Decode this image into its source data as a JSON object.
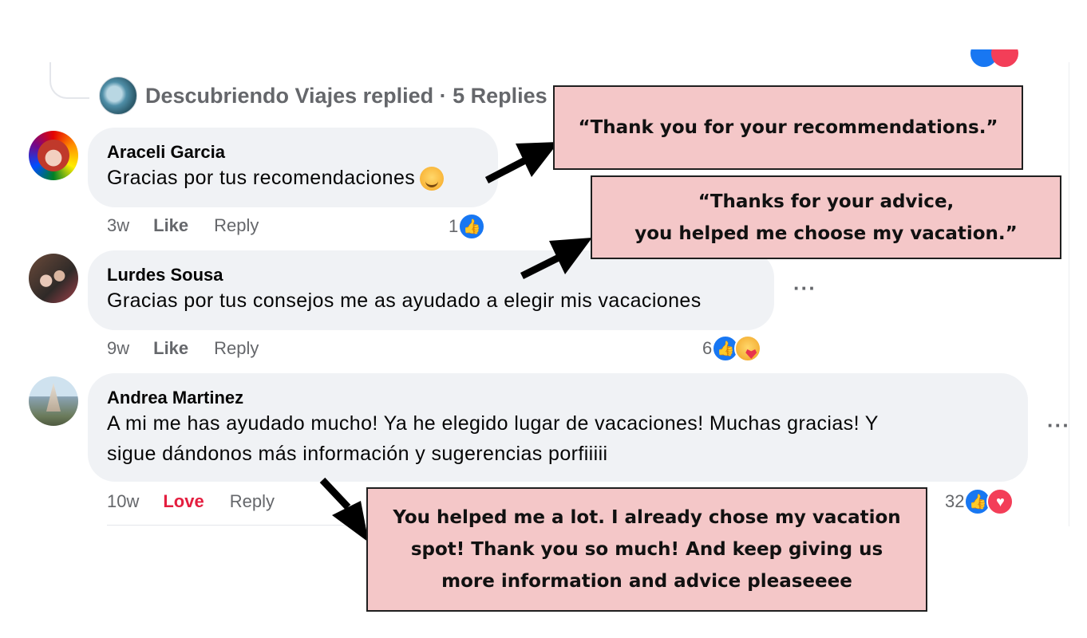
{
  "thread": {
    "replied_label": "Descubriendo Viajes replied · 5 Replies"
  },
  "comments": [
    {
      "author": "Araceli Garcia",
      "text": "Gracias por tus recomendaciones",
      "time": "3w",
      "action": "Like",
      "reply": "Reply",
      "reaction_count": "1",
      "reactions": [
        "like-icon"
      ]
    },
    {
      "author": "Lurdes Sousa",
      "text": "Gracias por tus consejos me as ayudado a elegir mis vacaciones",
      "time": "9w",
      "action": "Like",
      "reply": "Reply",
      "reaction_count": "6",
      "reactions": [
        "like-icon",
        "care-icon"
      ]
    },
    {
      "author": "Andrea Martinez",
      "text_line1": "A mi me has ayudado mucho! Ya he elegido lugar de vacaciones! Muchas gracias! Y",
      "text_line2": "sigue dándonos más información y sugerencias porfiiiii",
      "time": "10w",
      "action": "Love",
      "reply": "Reply",
      "reaction_count": "32",
      "reactions": [
        "like-icon",
        "love-icon"
      ]
    }
  ],
  "more_menu_glyph": "···",
  "callouts": {
    "c1": "“Thank you for your recommendations.”",
    "c2_line1": "“Thanks for your advice,",
    "c2_line2": "you helped me choose my vacation.”",
    "c3_line1": "You helped me a lot. I already chose my vacation",
    "c3_line2": "spot! Thank you so much! And keep giving us",
    "c3_line3": "more information and advice pleaseeee"
  },
  "colors": {
    "bubble_bg": "#f0f2f5",
    "callout_bg": "#f4c7c8",
    "like_blue": "#1877f2",
    "love_red": "#e41e3f",
    "meta_gray": "#65676b"
  }
}
